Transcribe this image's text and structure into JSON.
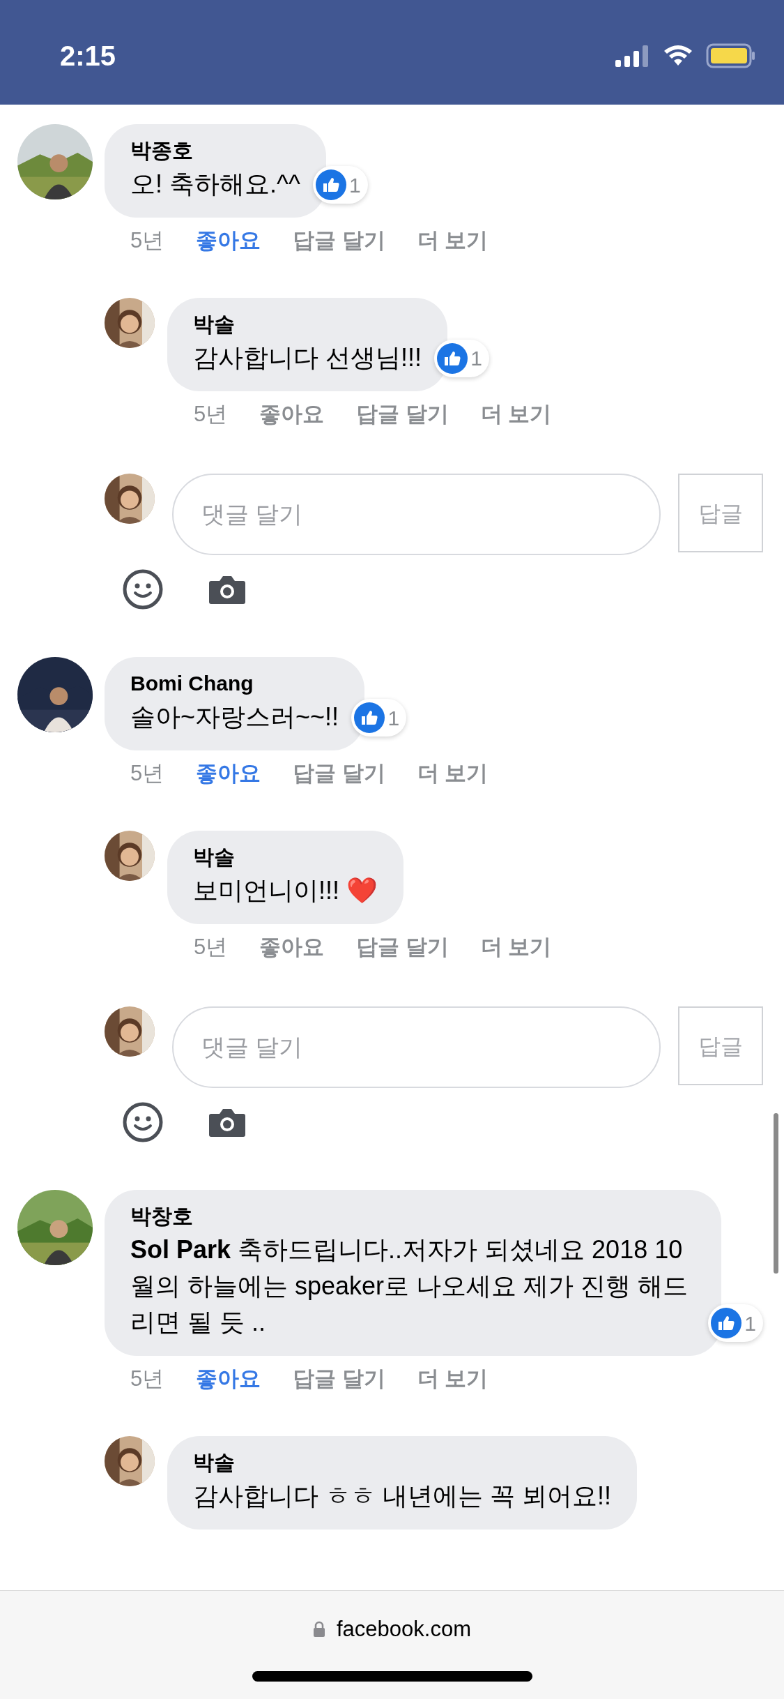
{
  "status_bar": {
    "time": "2:15"
  },
  "threads": [
    {
      "comment": {
        "name": "박종호",
        "text": "오! 축하해요.^^",
        "reaction_count": "1",
        "time": "5년",
        "actions": [
          {
            "label": "좋아요",
            "selected": true
          },
          {
            "label": "답글 달기",
            "selected": false
          },
          {
            "label": "더 보기",
            "selected": false
          }
        ]
      },
      "replies": [
        {
          "name": "박솔",
          "text": "감사합니다 선생님!!!",
          "reaction_count": "1",
          "time": "5년",
          "actions": [
            {
              "label": "좋아요",
              "selected": false
            },
            {
              "label": "답글 달기",
              "selected": false
            },
            {
              "label": "더 보기",
              "selected": false
            }
          ]
        }
      ],
      "reply_box": {
        "placeholder": "댓글 달기",
        "button": "답글"
      }
    },
    {
      "comment": {
        "name": "Bomi Chang",
        "text": "솔아~자랑스러~~!!",
        "reaction_count": "1",
        "time": "5년",
        "actions": [
          {
            "label": "좋아요",
            "selected": true
          },
          {
            "label": "답글 달기",
            "selected": false
          },
          {
            "label": "더 보기",
            "selected": false
          }
        ]
      },
      "replies": [
        {
          "name": "박솔",
          "text": "보미언니이!!! ❤️",
          "time": "5년",
          "actions": [
            {
              "label": "좋아요",
              "selected": false
            },
            {
              "label": "답글 달기",
              "selected": false
            },
            {
              "label": "더 보기",
              "selected": false
            }
          ]
        }
      ],
      "reply_box": {
        "placeholder": "댓글 달기",
        "button": "답글"
      }
    },
    {
      "comment": {
        "name": "박창호",
        "text": "**Sol Park** 축하드립니다..저자가 되셨네요 2018 10월의 하늘에는 speaker로 나오세요 제가 진행 해드리면 될 듯 ..",
        "reaction_count": "1",
        "time": "5년",
        "actions": [
          {
            "label": "좋아요",
            "selected": true
          },
          {
            "label": "답글 달기",
            "selected": false
          },
          {
            "label": "더 보기",
            "selected": false
          }
        ]
      },
      "replies": [
        {
          "name": "박솔",
          "text": "감사합니다 ㅎㅎ 내년에는 꼭 뵈어요!!"
        }
      ]
    }
  ],
  "address_bar": {
    "url": "facebook.com"
  }
}
